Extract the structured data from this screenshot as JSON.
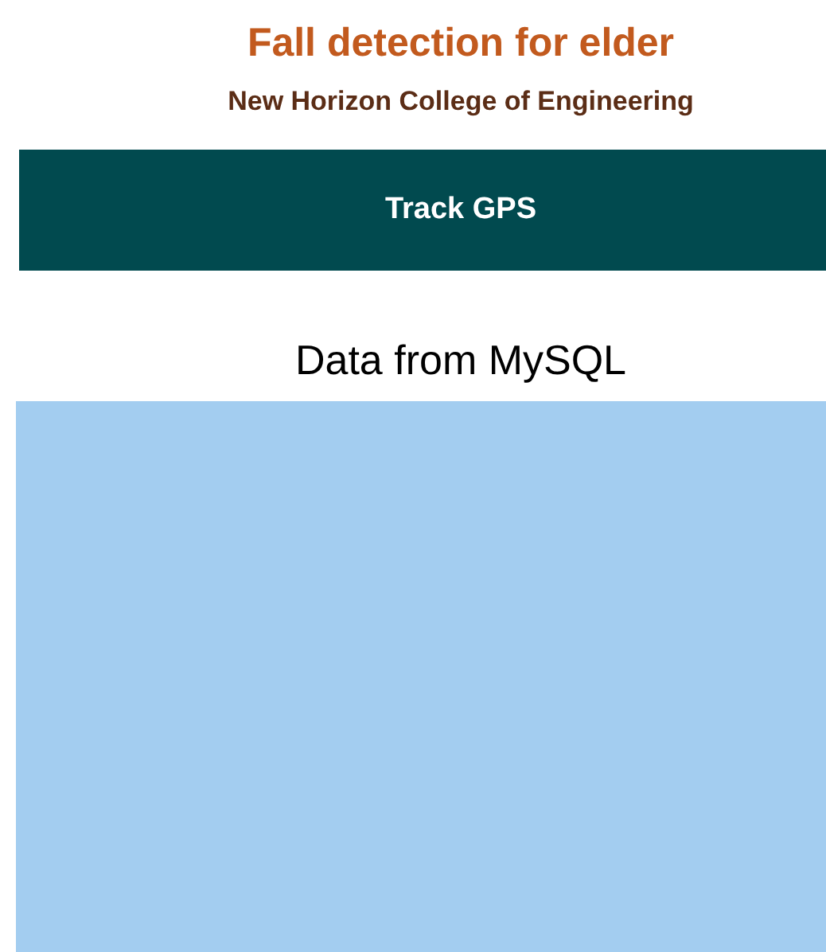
{
  "header": {
    "title": "Fall detection for elder",
    "subtitle": "New Horizon College of Engineering"
  },
  "track_button": {
    "label": "Track GPS"
  },
  "data_section": {
    "heading": "Data from MySQL"
  }
}
